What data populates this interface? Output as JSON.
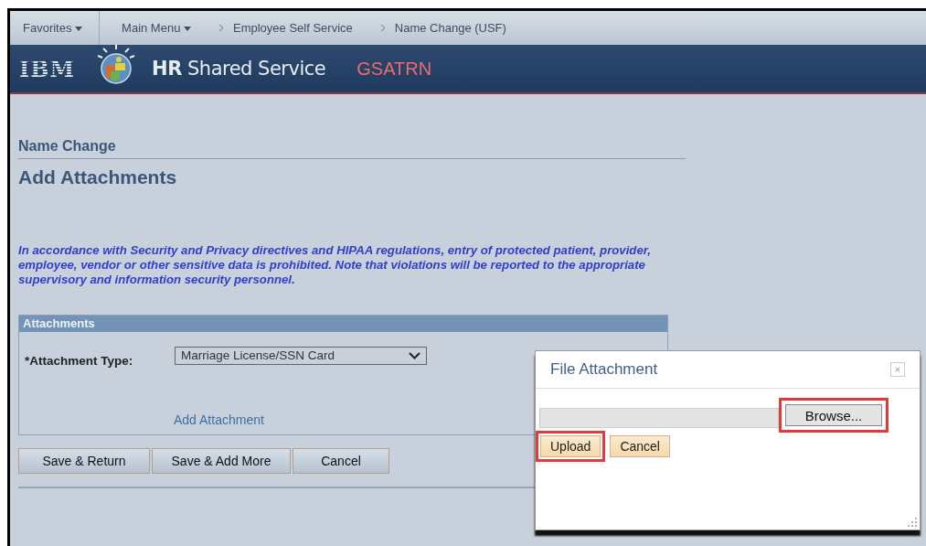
{
  "nav": {
    "favorites": "Favorites",
    "main_menu": "Main Menu",
    "breadcrumbs": [
      "Employee Self Service",
      "Name Change (USF)"
    ]
  },
  "header": {
    "logo": "IBM",
    "app_bold": "HR",
    "app_name": "Shared Service",
    "environment": "GSATRN"
  },
  "page": {
    "section": "Name Change",
    "title": "Add Attachments",
    "notice": "In accordance with Security and Privacy directives and HIPAA regulations, entry of protected patient, provider, employee, vendor or other sensitive data is prohibited. Note that violations will be reported to the appropriate supervisory and information security personnel."
  },
  "attachments": {
    "heading": "Attachments",
    "type_label": "*Attachment Type:",
    "type_value": "Marriage License/SSN Card",
    "add_link": "Add Attachment"
  },
  "buttons": [
    "Save & Return",
    "Save & Add More",
    "Cancel"
  ],
  "dialog": {
    "title": "File Attachment",
    "close": "×",
    "browse": {
      "label": "Browse...",
      "highlighted": true
    },
    "actions": [
      {
        "label": "Upload",
        "highlighted": true
      },
      {
        "label": "Cancel",
        "highlighted": false
      }
    ]
  }
}
